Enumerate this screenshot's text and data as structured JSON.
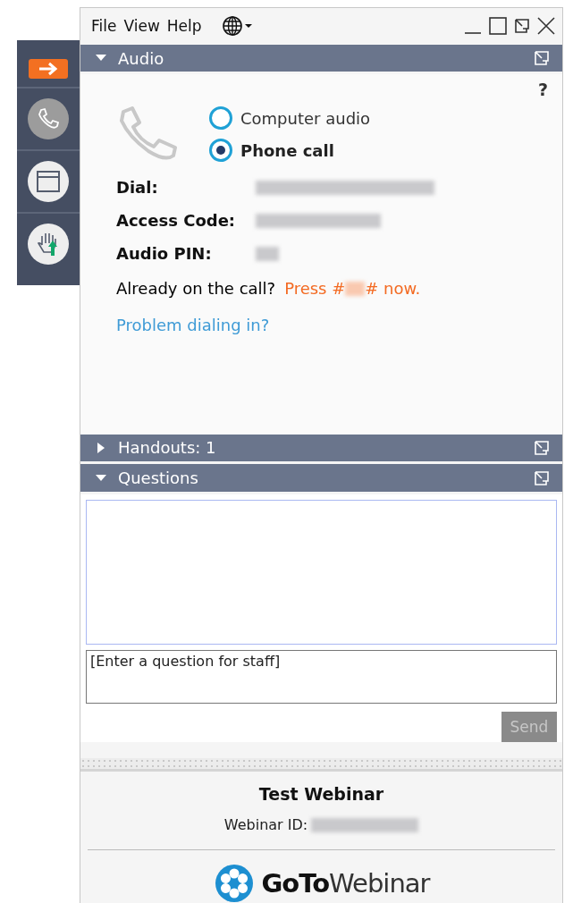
{
  "sidebar": [
    {
      "kind": "arrow",
      "selected": false
    },
    {
      "kind": "phone",
      "selected": true
    },
    {
      "kind": "window",
      "selected": false
    },
    {
      "kind": "hand",
      "selected": false
    }
  ],
  "menu": [
    "File",
    "View",
    "Help"
  ],
  "panels": [
    {
      "title": "Audio",
      "expanded": true
    },
    {
      "title": "Handouts: 1",
      "expanded": false
    },
    {
      "title": "Questions",
      "expanded": true
    }
  ],
  "audio": {
    "help": "?",
    "options": [
      {
        "label": "Computer audio",
        "selected": false
      },
      {
        "label": "Phone call",
        "selected": true
      }
    ],
    "details": [
      {
        "label": "Dial:"
      },
      {
        "label": "Access Code:"
      },
      {
        "label": "Audio PIN:"
      }
    ],
    "already": "Already on the call?",
    "press_before": "Press #",
    "press_after": "# now.",
    "problem_link": "Problem dialing in?"
  },
  "questions": {
    "placeholder": "[Enter a question for staff]",
    "send": "Send",
    "send_disabled": true
  },
  "footer": {
    "title": "Test Webinar",
    "id_label": "Webinar ID:",
    "logo": "**GoTo**Webinar"
  }
}
